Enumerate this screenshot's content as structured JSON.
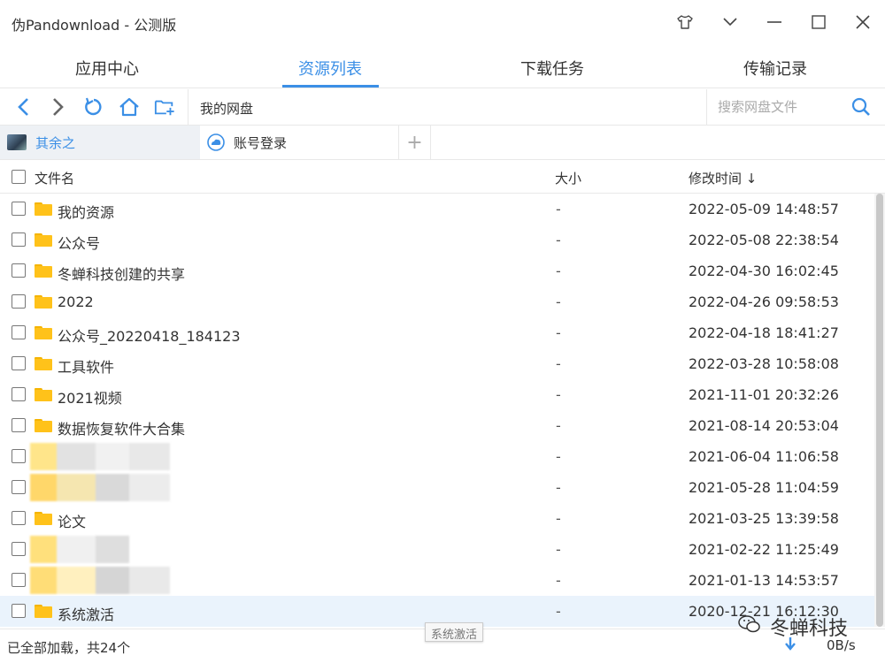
{
  "window": {
    "title": "伪Pandownload - 公测版"
  },
  "tabs": [
    {
      "label": "应用中心",
      "active": false
    },
    {
      "label": "资源列表",
      "active": true
    },
    {
      "label": "下载任务",
      "active": false
    },
    {
      "label": "传输记录",
      "active": false
    }
  ],
  "toolbar": {
    "path": "我的网盘",
    "search_placeholder": "搜索网盘文件"
  },
  "accounts": [
    {
      "label": "其余之",
      "active": true
    },
    {
      "label": "账号登录",
      "active": false
    }
  ],
  "list": {
    "headers": {
      "name": "文件名",
      "size": "大小",
      "time": "修改时间 ↓"
    },
    "rows": [
      {
        "name": "我的资源",
        "size": "-",
        "time": "2022-05-09 14:48:57"
      },
      {
        "name": "公众号",
        "size": "-",
        "time": "2022-05-08 22:38:54"
      },
      {
        "name": "冬蝉科技创建的共享",
        "size": "-",
        "time": "2022-04-30 16:02:45"
      },
      {
        "name": "2022",
        "size": "-",
        "time": "2022-04-26 09:58:53"
      },
      {
        "name": "公众号_20220418_184123",
        "size": "-",
        "time": "2022-04-18 18:41:27"
      },
      {
        "name": "工具软件",
        "size": "-",
        "time": "2022-03-28 10:58:08"
      },
      {
        "name": "2021视频",
        "size": "-",
        "time": "2021-11-01 20:32:26"
      },
      {
        "name": "数据恢复软件大合集",
        "size": "-",
        "time": "2021-08-14 20:53:04"
      },
      {
        "name": "",
        "size": "-",
        "time": "2021-06-04 11:06:58",
        "blurred": true
      },
      {
        "name": "",
        "size": "-",
        "time": "2021-05-28 11:04:59",
        "blurred": true
      },
      {
        "name": "论文",
        "size": "-",
        "time": "2021-03-25 13:39:58"
      },
      {
        "name": "",
        "size": "-",
        "time": "2021-02-22 11:25:49",
        "blurred": true
      },
      {
        "name": "",
        "size": "-",
        "time": "2021-01-13 14:53:57",
        "blurred": true
      },
      {
        "name": "系统激活",
        "size": "-",
        "time": "2020-12-21 16:12:30",
        "selected": true
      }
    ]
  },
  "status": {
    "text": "已全部加载，共24个",
    "tooltip": "系统激活",
    "speed": "0B/s"
  },
  "watermark": "冬蝉科技",
  "colors": {
    "accent": "#3b8fe6",
    "folder": "#ffc21a",
    "selected_row": "#eaf3fc"
  }
}
